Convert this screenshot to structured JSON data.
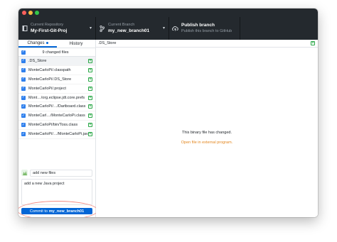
{
  "toolbar": {
    "repo_label": "Current Repository",
    "repo_name": "My-First-Git-Proj",
    "branch_label": "Current Branch",
    "branch_name": "my_new_branch01",
    "publish_title": "Publish branch",
    "publish_subtitle": "Publish this branch to GitHub"
  },
  "sidebar": {
    "tabs": [
      {
        "label": "Changes",
        "active": true
      },
      {
        "label": "History",
        "active": false
      }
    ],
    "changed_count": "9 changed files",
    "files": [
      {
        "name": ".DS_Store",
        "selected": true
      },
      {
        "name": "MonteCarloPi/.classpath",
        "selected": false
      },
      {
        "name": "MonteCarloPi/.DS_Store",
        "selected": false
      },
      {
        "name": "MonteCarloPi/.project",
        "selected": false
      },
      {
        "name": "Mont…/org.eclipse.jdt.core.prefs",
        "selected": false
      },
      {
        "name": "MonteCarloPi/…/Dartboard.class",
        "selected": false
      },
      {
        "name": "MonteCarl…/MonteCarloPi.class",
        "selected": false
      },
      {
        "name": "MonteCarloPi/bin/Toss.class",
        "selected": false
      },
      {
        "name": "MonteCarloPi/…/MonteCarloPi.java",
        "selected": false
      }
    ]
  },
  "commit": {
    "summary": "add new files",
    "description": "add a new Java project",
    "button_prefix": "Commit to",
    "button_branch": "my_new_branch01"
  },
  "main": {
    "file_path": ".DS_Store",
    "binary_message": "This binary file has changed.",
    "open_link": "Open file in external program."
  },
  "colors": {
    "toolbar_bg": "#24292e",
    "accent_blue": "#0366d6",
    "added_green": "#28a745",
    "link_orange": "#e3861e"
  }
}
